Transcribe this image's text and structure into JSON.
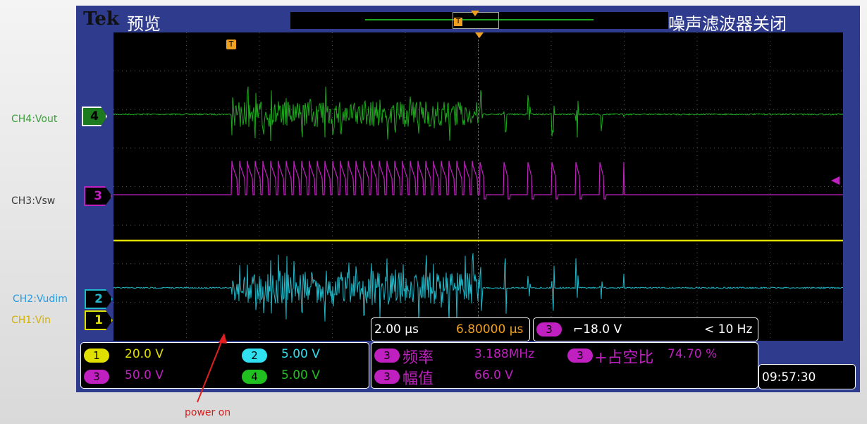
{
  "header": {
    "brand": "Tek",
    "mode": "预览",
    "noise_filter": "噪声滤波器关闭"
  },
  "channels": [
    {
      "side_label": "CH4:Vout",
      "marker": "4",
      "color": "#1ea81e",
      "label_color": "#3aa03a"
    },
    {
      "side_label": "CH3:Vsw",
      "marker": "3",
      "color": "#c020c0",
      "label_color": "#3c3c3c"
    },
    {
      "side_label": "CH2:Vudim",
      "marker": "2",
      "color": "#20b8c8",
      "label_color": "#2a9be0"
    },
    {
      "side_label": "CH1:Vin",
      "marker": "1",
      "color": "#e0e000",
      "label_color": "#d4b000"
    }
  ],
  "scales": [
    {
      "ch": "1",
      "value": "20.0 V"
    },
    {
      "ch": "2",
      "value": "5.00 V"
    },
    {
      "ch": "3",
      "value": "50.0 V"
    },
    {
      "ch": "4",
      "value": "5.00 V"
    }
  ],
  "timebase": {
    "per_div": "2.00 μs",
    "delay": "6.80000 μs"
  },
  "trigger": {
    "source": "3",
    "slope_level": "⌐18.0 V",
    "rate": "< 10 Hz"
  },
  "measurements": [
    {
      "ch": "3",
      "name": "频率",
      "value": "3.188MHz"
    },
    {
      "ch": "3",
      "name": "+占空比",
      "value": "74.70 %"
    },
    {
      "ch": "3",
      "name": "幅值",
      "value": "66.0 V"
    }
  ],
  "clock": "09:57:30",
  "annotation": {
    "text": "power on",
    "color": "#d02020"
  }
}
